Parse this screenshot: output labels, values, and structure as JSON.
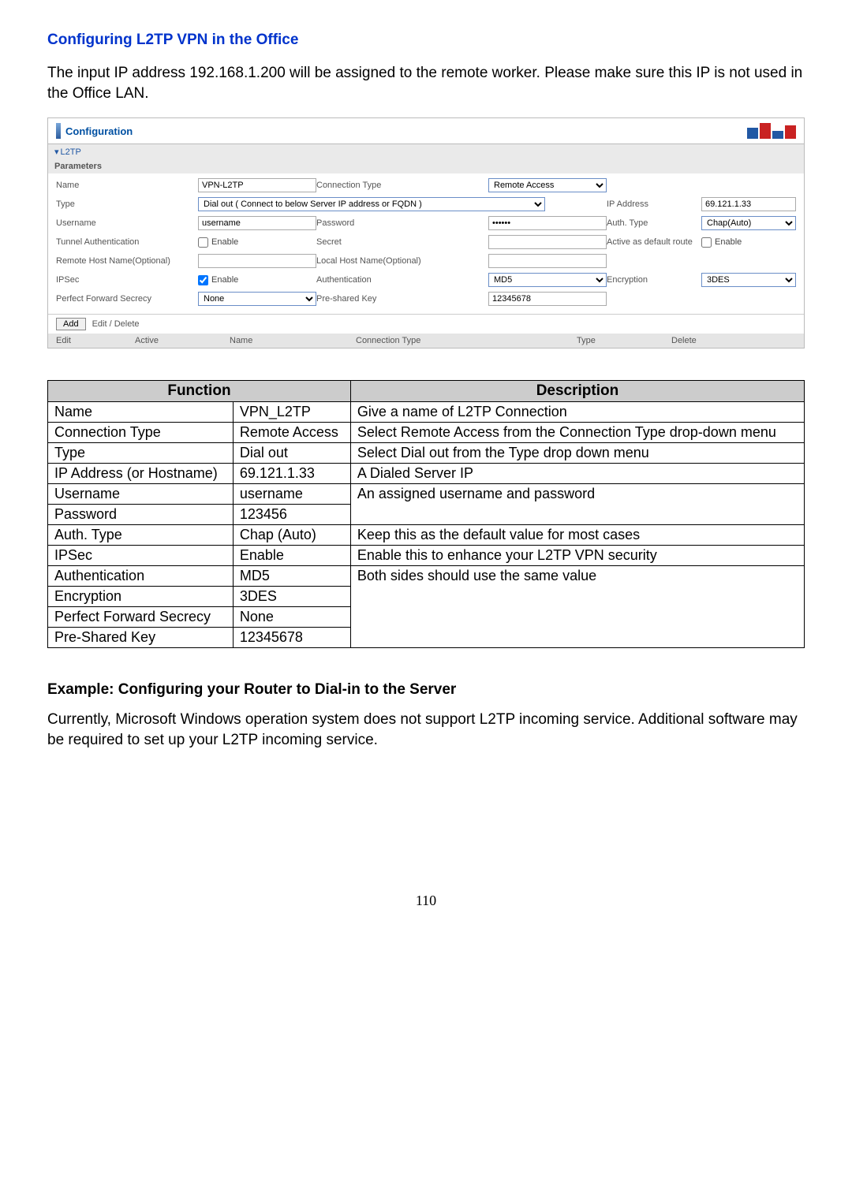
{
  "headingBlue": "Configuring L2TP VPN in the Office",
  "intro": "The input IP address 192.168.1.200 will be assigned to the remote worker. Please make sure this IP is not used in the Office LAN.",
  "panel": {
    "title": "Configuration",
    "tab_l2tp": "L2TP",
    "tab_param": "Parameters",
    "labels": {
      "name": "Name",
      "conn_type": "Connection Type",
      "type": "Type",
      "ip_addr": "IP Address",
      "username": "Username",
      "password": "Password",
      "auth_type": "Auth. Type",
      "tunnel_auth": "Tunnel Authentication",
      "secret": "Secret",
      "active_default": "Active as default route",
      "remote_host": "Remote Host Name(Optional)",
      "local_host": "Local Host Name(Optional)",
      "ipsec": "IPSec",
      "authentication": "Authentication",
      "encryption": "Encryption",
      "pfs": "Perfect Forward Secrecy",
      "psk": "Pre-shared Key",
      "enable": "Enable"
    },
    "values": {
      "name": "VPN-L2TP",
      "conn_type": "Remote Access",
      "type": "Dial out ( Connect to below Server IP address or FQDN )",
      "ip_addr": "69.121.1.33",
      "username": "username",
      "password": "••••••",
      "auth_type": "Chap(Auto)",
      "secret": "",
      "remote_host": "",
      "local_host": "",
      "authentication": "MD5",
      "encryption": "3DES",
      "pfs": "None",
      "psk": "12345678"
    },
    "add_btn": "Add",
    "edit_del": "Edit / Delete",
    "listhdr": {
      "edit": "Edit",
      "active": "Active",
      "name": "Name",
      "conn_type": "Connection Type",
      "type": "Type",
      "delete": "Delete"
    }
  },
  "ftab": {
    "function_hdr": "Function",
    "description_hdr": "Description",
    "rows": {
      "name": {
        "f": "Name",
        "v": "VPN_L2TP",
        "d": "Give a name of L2TP Connection"
      },
      "conn_type": {
        "f": "Connection Type",
        "v": "Remote Access",
        "d": "Select Remote Access from the Connection Type drop-down menu"
      },
      "type": {
        "f": "Type",
        "v": "Dial out",
        "d": "Select Dial out from the Type drop down menu"
      },
      "ip": {
        "f": "IP Address (or Hostname)",
        "v": "69.121.1.33",
        "d": "A Dialed Server IP"
      },
      "user": {
        "f": "Username",
        "v": "username",
        "d": "An assigned username and password"
      },
      "pass": {
        "f": "Password",
        "v": "123456"
      },
      "auth": {
        "f": "Auth. Type",
        "v": "Chap (Auto)",
        "d": "Keep this as the default value for most cases"
      },
      "ipsec": {
        "f": "IPSec",
        "v": "Enable",
        "d": "Enable this to enhance your L2TP VPN security"
      },
      "authn": {
        "f": "Authentication",
        "v": "MD5",
        "d": "Both sides should use the same value"
      },
      "enc": {
        "f": "Encryption",
        "v": "3DES"
      },
      "pfs": {
        "f": "Perfect Forward Secrecy",
        "v": "None"
      },
      "psk": {
        "f": "Pre-Shared Key",
        "v": "12345678"
      }
    }
  },
  "example_heading": "Example: Configuring your Router to Dial-in to the Server",
  "example_body": "Currently, Microsoft Windows operation system does not support L2TP incoming service. Additional software may be required to set up your L2TP incoming service.",
  "page_num": "110"
}
